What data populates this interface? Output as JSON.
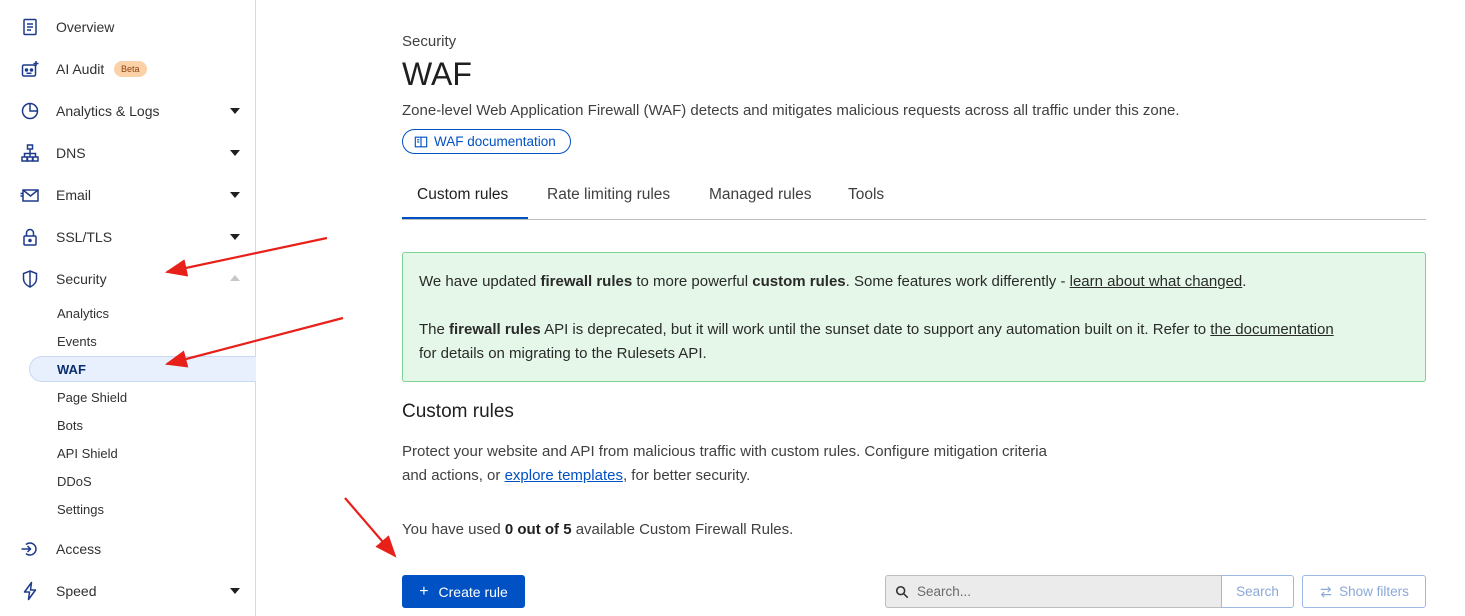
{
  "sidebar": {
    "items": [
      {
        "label": "Overview",
        "icon": "document-icon"
      },
      {
        "label": "AI Audit",
        "icon": "robot-icon",
        "badge": "Beta"
      },
      {
        "label": "Analytics & Logs",
        "icon": "pie-chart-icon"
      },
      {
        "label": "DNS",
        "icon": "network-icon"
      },
      {
        "label": "Email",
        "icon": "envelope-icon"
      },
      {
        "label": "SSL/TLS",
        "icon": "lock-icon"
      },
      {
        "label": "Security",
        "icon": "shield-icon"
      },
      {
        "label": "Access",
        "icon": "access-icon"
      },
      {
        "label": "Speed",
        "icon": "lightning-icon"
      }
    ],
    "security_sub": [
      {
        "label": "Analytics"
      },
      {
        "label": "Events"
      },
      {
        "label": "WAF"
      },
      {
        "label": "Page Shield"
      },
      {
        "label": "Bots"
      },
      {
        "label": "API Shield"
      },
      {
        "label": "DDoS"
      },
      {
        "label": "Settings"
      }
    ]
  },
  "header": {
    "eyebrow": "Security",
    "title": "WAF",
    "description": "Zone-level Web Application Firewall (WAF) detects and mitigates malicious requests across all traffic under this zone.",
    "doc_button": "WAF documentation"
  },
  "tabs": [
    {
      "label": "Custom rules"
    },
    {
      "label": "Rate limiting rules"
    },
    {
      "label": "Managed rules"
    },
    {
      "label": "Tools"
    }
  ],
  "alert": {
    "line1_a": "We have updated ",
    "line1_b": "firewall rules",
    "line1_c": " to more powerful ",
    "line1_d": "custom rules",
    "line1_e": ". Some features work differently - ",
    "line1_link": "learn about what changed",
    "line1_f": ".",
    "line2_a": "The ",
    "line2_b": "firewall rules",
    "line2_c": " API is deprecated, but it will work until the sunset date to support any automation built on it. Refer to ",
    "line2_link": "the documentation",
    "line3": "for details on migrating to the Rulesets API."
  },
  "custom_rules": {
    "heading": "Custom rules",
    "para_a": "Protect your website and API from malicious traffic with custom rules. Configure mitigation criteria and actions, or ",
    "para_link": "explore templates",
    "para_b": ", for better security.",
    "usage_a": "You have used ",
    "usage_b": "0 out of 5",
    "usage_c": " available Custom Firewall Rules.",
    "create_button": "Create rule",
    "search_placeholder": "Search...",
    "search_button": "Search",
    "filters_button": "Show filters"
  },
  "colors": {
    "accent": "#0051c3",
    "alert_bg": "#e5f7e8",
    "alert_border": "#7dd292",
    "annotation_arrow": "#e8201a"
  }
}
